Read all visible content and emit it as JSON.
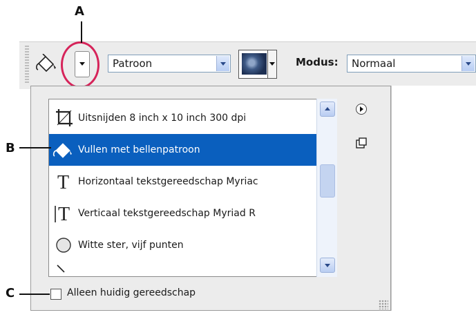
{
  "callouts": {
    "a": "A",
    "b": "B",
    "c": "C"
  },
  "toolbar": {
    "tool_icon": "paint-bucket-icon",
    "preset_picker_icon": "chevron-down-icon",
    "fill_source": "Patroon",
    "pattern_swatch_icon": "pattern-swatch-icon",
    "mode_label": "Modus:",
    "mode_value": "Normaal"
  },
  "preset_list": {
    "items": [
      {
        "label": "Uitsnijden 8 inch x 10 inch 300 dpi",
        "icon": "crop-icon",
        "selected": false
      },
      {
        "label": "Vullen met bellenpatroon",
        "icon": "paint-bucket-icon",
        "selected": true
      },
      {
        "label": "Horizontaal tekstgereedschap Myriac",
        "icon": "horizontal-type-icon",
        "selected": false
      },
      {
        "label": "Verticaal tekstgereedschap Myriad R",
        "icon": "vertical-type-icon",
        "selected": false
      },
      {
        "label": "Witte ster, vijf punten",
        "icon": "custom-shape-icon",
        "selected": false
      }
    ]
  },
  "panel": {
    "menu_button_icon": "panel-menu-icon",
    "new_preset_icon": "new-preset-icon",
    "current_tool_only_label": "Alleen huidig gereedschap",
    "current_tool_only_checked": false
  },
  "colors": {
    "selection": "#0a5fbe",
    "highlight_circle": "#d6245a"
  }
}
